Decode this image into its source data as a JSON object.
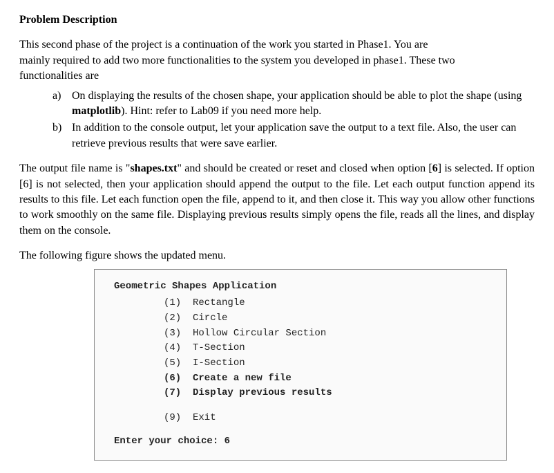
{
  "heading": "Problem Description",
  "intro": {
    "line1": "This second phase of the project is a continuation of the work you started in Phase1. You are",
    "line2": "mainly required to add two more functionalities to the system you developed in phase1. These two",
    "line3": "functionalities are"
  },
  "items": {
    "a": {
      "marker": "a)",
      "part1": "On displaying the results of the chosen shape, your application should be able to plot the shape (using ",
      "bold": "matplotlib",
      "part2": "). Hint: refer to Lab09 if you need more help."
    },
    "b": {
      "marker": "b)",
      "text": "In addition to the console output, let your application save the output to a text file. Also, the user can retrieve previous results that were save earlier."
    }
  },
  "para2": {
    "pre1": "The output file name is \"",
    "bold1": "shapes.txt",
    "mid1": "\" and should be created or reset and closed when option [",
    "bold2": "6",
    "post1": "] is selected. If option [6] is not selected, then your application should append the output to the file. Let each output function append its results to this file. Let each function open the file, append to it, and then close it. This way you allow other functions to work smoothly on the same file. Displaying previous results simply opens the file, reads all the lines, and display them on the console."
  },
  "para3": "The following figure shows the updated menu.",
  "menu": {
    "title": "Geometric Shapes Application",
    "opt1": "(1)  Rectangle",
    "opt2": "(2)  Circle",
    "opt3": "(3)  Hollow Circular Section",
    "opt4": "(4)  T-Section",
    "opt5": "(5)  I-Section",
    "opt6": "(6)  Create a new file",
    "opt7": "(7)  Display previous results",
    "opt9": "(9)  Exit",
    "prompt": "Enter your choice: 6"
  }
}
